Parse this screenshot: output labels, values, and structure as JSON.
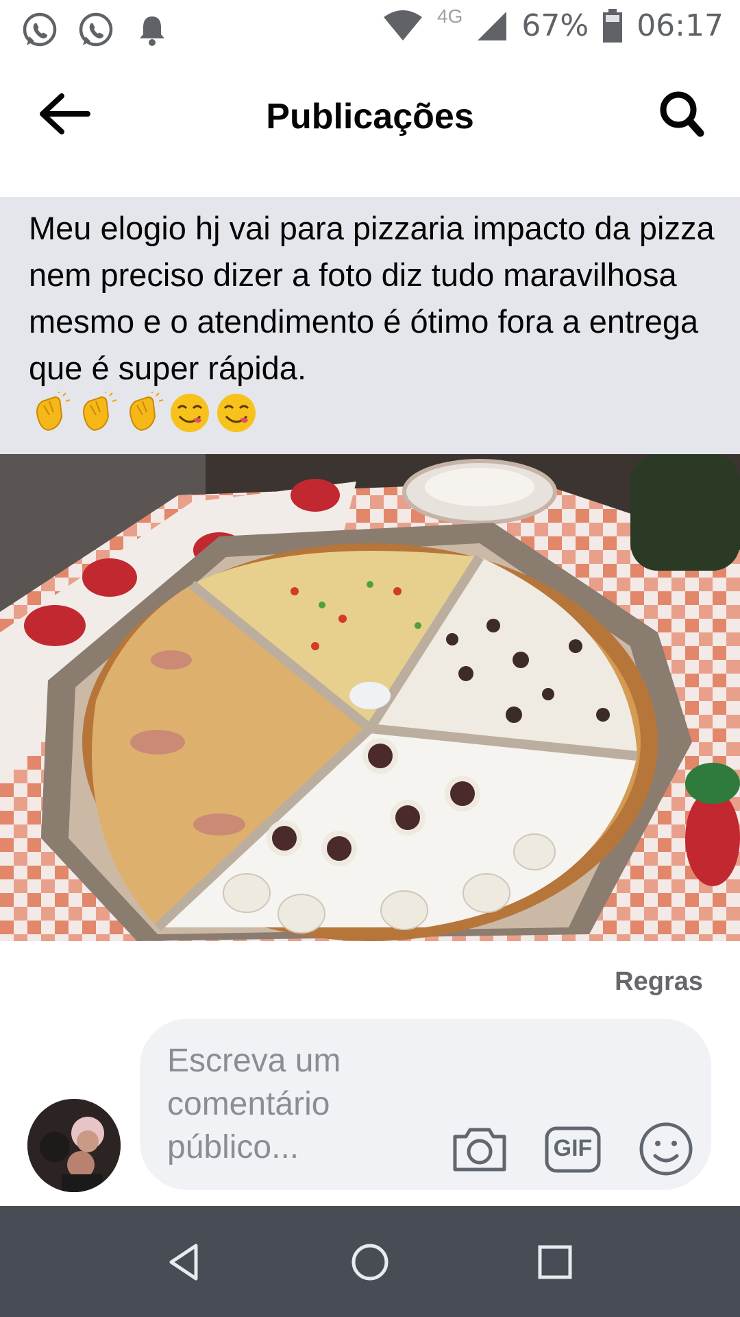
{
  "status_bar": {
    "icons": [
      "whatsapp-icon",
      "whatsapp-icon",
      "bell-icon",
      "wifi-icon",
      "signal-icon",
      "battery-icon"
    ],
    "network": "4G",
    "battery": "67%",
    "time": "06:17"
  },
  "header": {
    "title": "Publicações",
    "back_icon": "arrow-left-icon",
    "search_icon": "search-icon"
  },
  "post": {
    "text": "Meu elogio hj vai para pizzaria  impacto da pizza nem preciso dizer a foto diz tudo maravilhosa mesmo e o atendimento é ótimo fora a entrega que é super rápida.",
    "emojis": [
      "clapping-hands-icon",
      "clapping-hands-icon",
      "clapping-hands-icon",
      "yum-face-icon",
      "yum-face-icon"
    ]
  },
  "rules_link": "Regras",
  "comment": {
    "placeholder": "Escreva um comentário público...",
    "camera_icon": "camera-icon",
    "gif_label": "GIF",
    "emoji_icon": "smiley-icon"
  },
  "nav": {
    "back_icon": "nav-back-icon",
    "home_icon": "nav-home-icon",
    "recents_icon": "nav-recents-icon"
  },
  "colors": {
    "post_bg": "#e5e6eb",
    "comment_bg": "#f0f2f5",
    "navbar_bg": "#474c55",
    "muted_text": "#65676b"
  }
}
